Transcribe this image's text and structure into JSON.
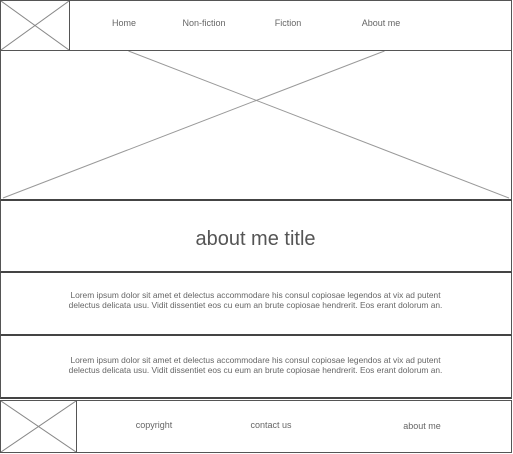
{
  "header": {
    "logo_icon": "image-placeholder-icon",
    "nav": [
      {
        "label": "Home"
      },
      {
        "label": "Non-fiction"
      },
      {
        "label": "Fiction"
      },
      {
        "label": "About me"
      }
    ]
  },
  "hero": {
    "icon": "image-placeholder-icon"
  },
  "main": {
    "title": "about me title",
    "paragraphs": [
      {
        "line1": "Lorem ipsum dolor sit amet et delectus accommodare his consul copiosae legendos at vix ad putent",
        "line2": "delectus delicata usu. Vidit dissentiet eos cu eum an brute copiosae hendrerit. Eos erant dolorum an."
      },
      {
        "line1": "Lorem ipsum dolor sit amet et delectus accommodare his consul copiosae legendos at vix ad putent",
        "line2": "delectus delicata usu. Vidit dissentiet eos cu eum an brute copiosae hendrerit. Eos erant dolorum an."
      }
    ]
  },
  "footer": {
    "logo_icon": "image-placeholder-icon",
    "links": [
      {
        "label": "copyright"
      },
      {
        "label": "contact us"
      },
      {
        "label": "about me"
      }
    ]
  }
}
